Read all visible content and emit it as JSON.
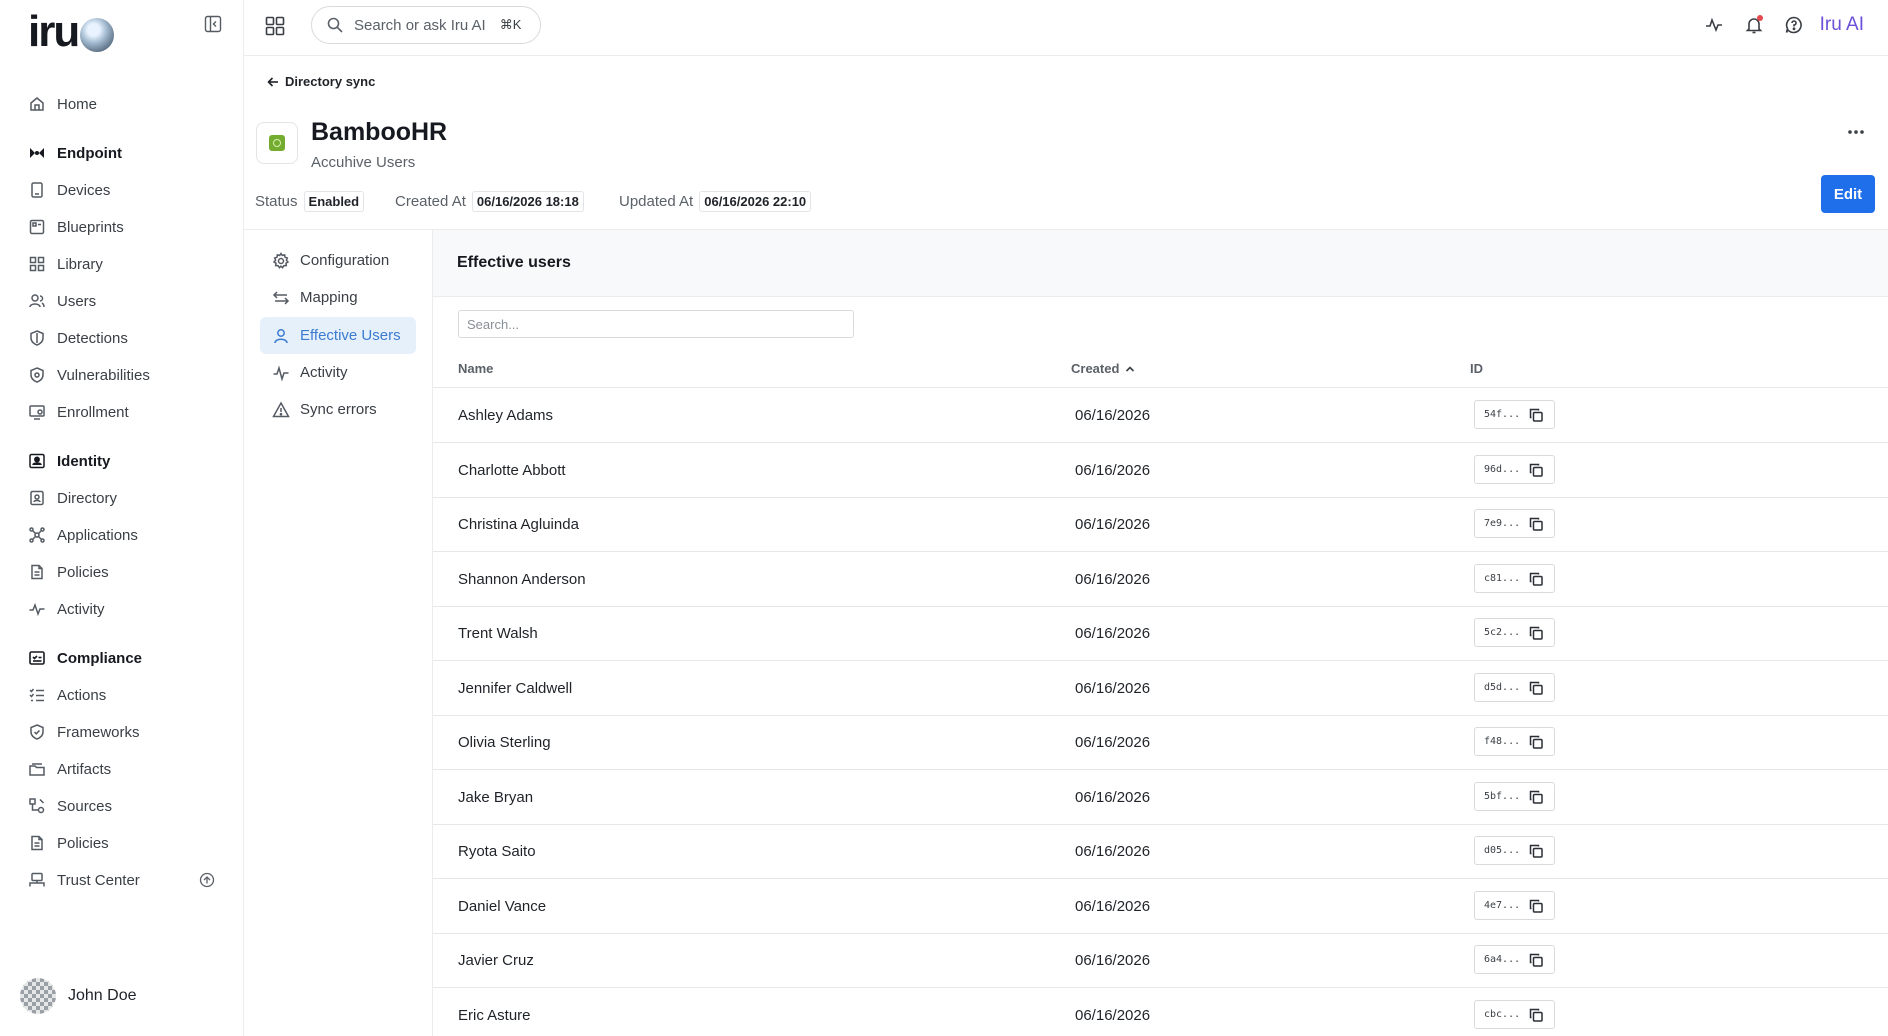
{
  "brand": {
    "logo_text": "iru"
  },
  "nav": {
    "home": "Home",
    "endpoint": "Endpoint",
    "devices": "Devices",
    "blueprints": "Blueprints",
    "library": "Library",
    "users": "Users",
    "detections": "Detections",
    "vulnerabilities": "Vulnerabilities",
    "enrollment": "Enrollment",
    "identity": "Identity",
    "directory": "Directory",
    "applications": "Applications",
    "identity_policies": "Policies",
    "activity": "Activity",
    "compliance": "Compliance",
    "actions": "Actions",
    "frameworks": "Frameworks",
    "artifacts": "Artifacts",
    "sources": "Sources",
    "compliance_policies": "Policies",
    "trust_center": "Trust Center"
  },
  "user": {
    "name": "John Doe"
  },
  "topbar": {
    "search_placeholder": "Search or ask Iru AI",
    "search_shortcut": "⌘K",
    "ai_label": "Iru AI"
  },
  "page": {
    "back_label": "Directory sync",
    "title": "BambooHR",
    "subtitle": "Accuhive Users",
    "status_label": "Status",
    "status_value": "Enabled",
    "created_label": "Created At",
    "created_value": "06/16/2026 18:18",
    "updated_label": "Updated At",
    "updated_value": "06/16/2026 22:10",
    "edit_label": "Edit"
  },
  "subnav": {
    "configuration": "Configuration",
    "mapping": "Mapping",
    "effective_users": "Effective Users",
    "activity": "Activity",
    "sync_errors": "Sync errors"
  },
  "panel": {
    "title": "Effective users",
    "search_placeholder": "Search...",
    "columns": {
      "name": "Name",
      "created": "Created",
      "id": "ID"
    },
    "sort": {
      "column": "Created",
      "direction": "ascending"
    },
    "rows": [
      {
        "name": "Ashley Adams",
        "created": "06/16/2026",
        "id": "54f..."
      },
      {
        "name": "Charlotte Abbott",
        "created": "06/16/2026",
        "id": "96d..."
      },
      {
        "name": "Christina Agluinda",
        "created": "06/16/2026",
        "id": "7e9..."
      },
      {
        "name": "Shannon Anderson",
        "created": "06/16/2026",
        "id": "c81..."
      },
      {
        "name": "Trent Walsh",
        "created": "06/16/2026",
        "id": "5c2..."
      },
      {
        "name": "Jennifer Caldwell",
        "created": "06/16/2026",
        "id": "d5d..."
      },
      {
        "name": "Olivia Sterling",
        "created": "06/16/2026",
        "id": "f48..."
      },
      {
        "name": "Jake Bryan",
        "created": "06/16/2026",
        "id": "5bf..."
      },
      {
        "name": "Ryota Saito",
        "created": "06/16/2026",
        "id": "d05..."
      },
      {
        "name": "Daniel Vance",
        "created": "06/16/2026",
        "id": "4e7..."
      },
      {
        "name": "Javier Cruz",
        "created": "06/16/2026",
        "id": "6a4..."
      },
      {
        "name": "Eric Asture",
        "created": "06/16/2026",
        "id": "cbc..."
      }
    ]
  },
  "colors": {
    "accent": "#1f6feb",
    "active_nav_bg": "#e6f0fb",
    "active_nav_text": "#3b7bd0",
    "ai_brand": "#6b4fd8",
    "bamboohr_green": "#73ac2e"
  },
  "icons": {
    "home": "home-icon",
    "endpoint": "endpoint-icon",
    "devices": "devices-icon",
    "blueprints": "blueprints-icon",
    "library": "library-icon",
    "users": "users-icon",
    "detections": "shield-icon",
    "vulnerabilities": "vulnerability-icon",
    "enrollment": "enrollment-icon",
    "identity": "identity-icon",
    "directory": "directory-icon",
    "applications": "applications-icon",
    "policies": "policy-icon",
    "activity": "pulse-icon",
    "compliance": "compliance-icon",
    "actions": "checklist-icon",
    "frameworks": "shield-check-icon",
    "artifacts": "artifacts-icon",
    "sources": "sources-icon",
    "trust_center": "trust-center-icon",
    "copy": "copy-icon",
    "sort_up": "chevron-up-icon"
  }
}
